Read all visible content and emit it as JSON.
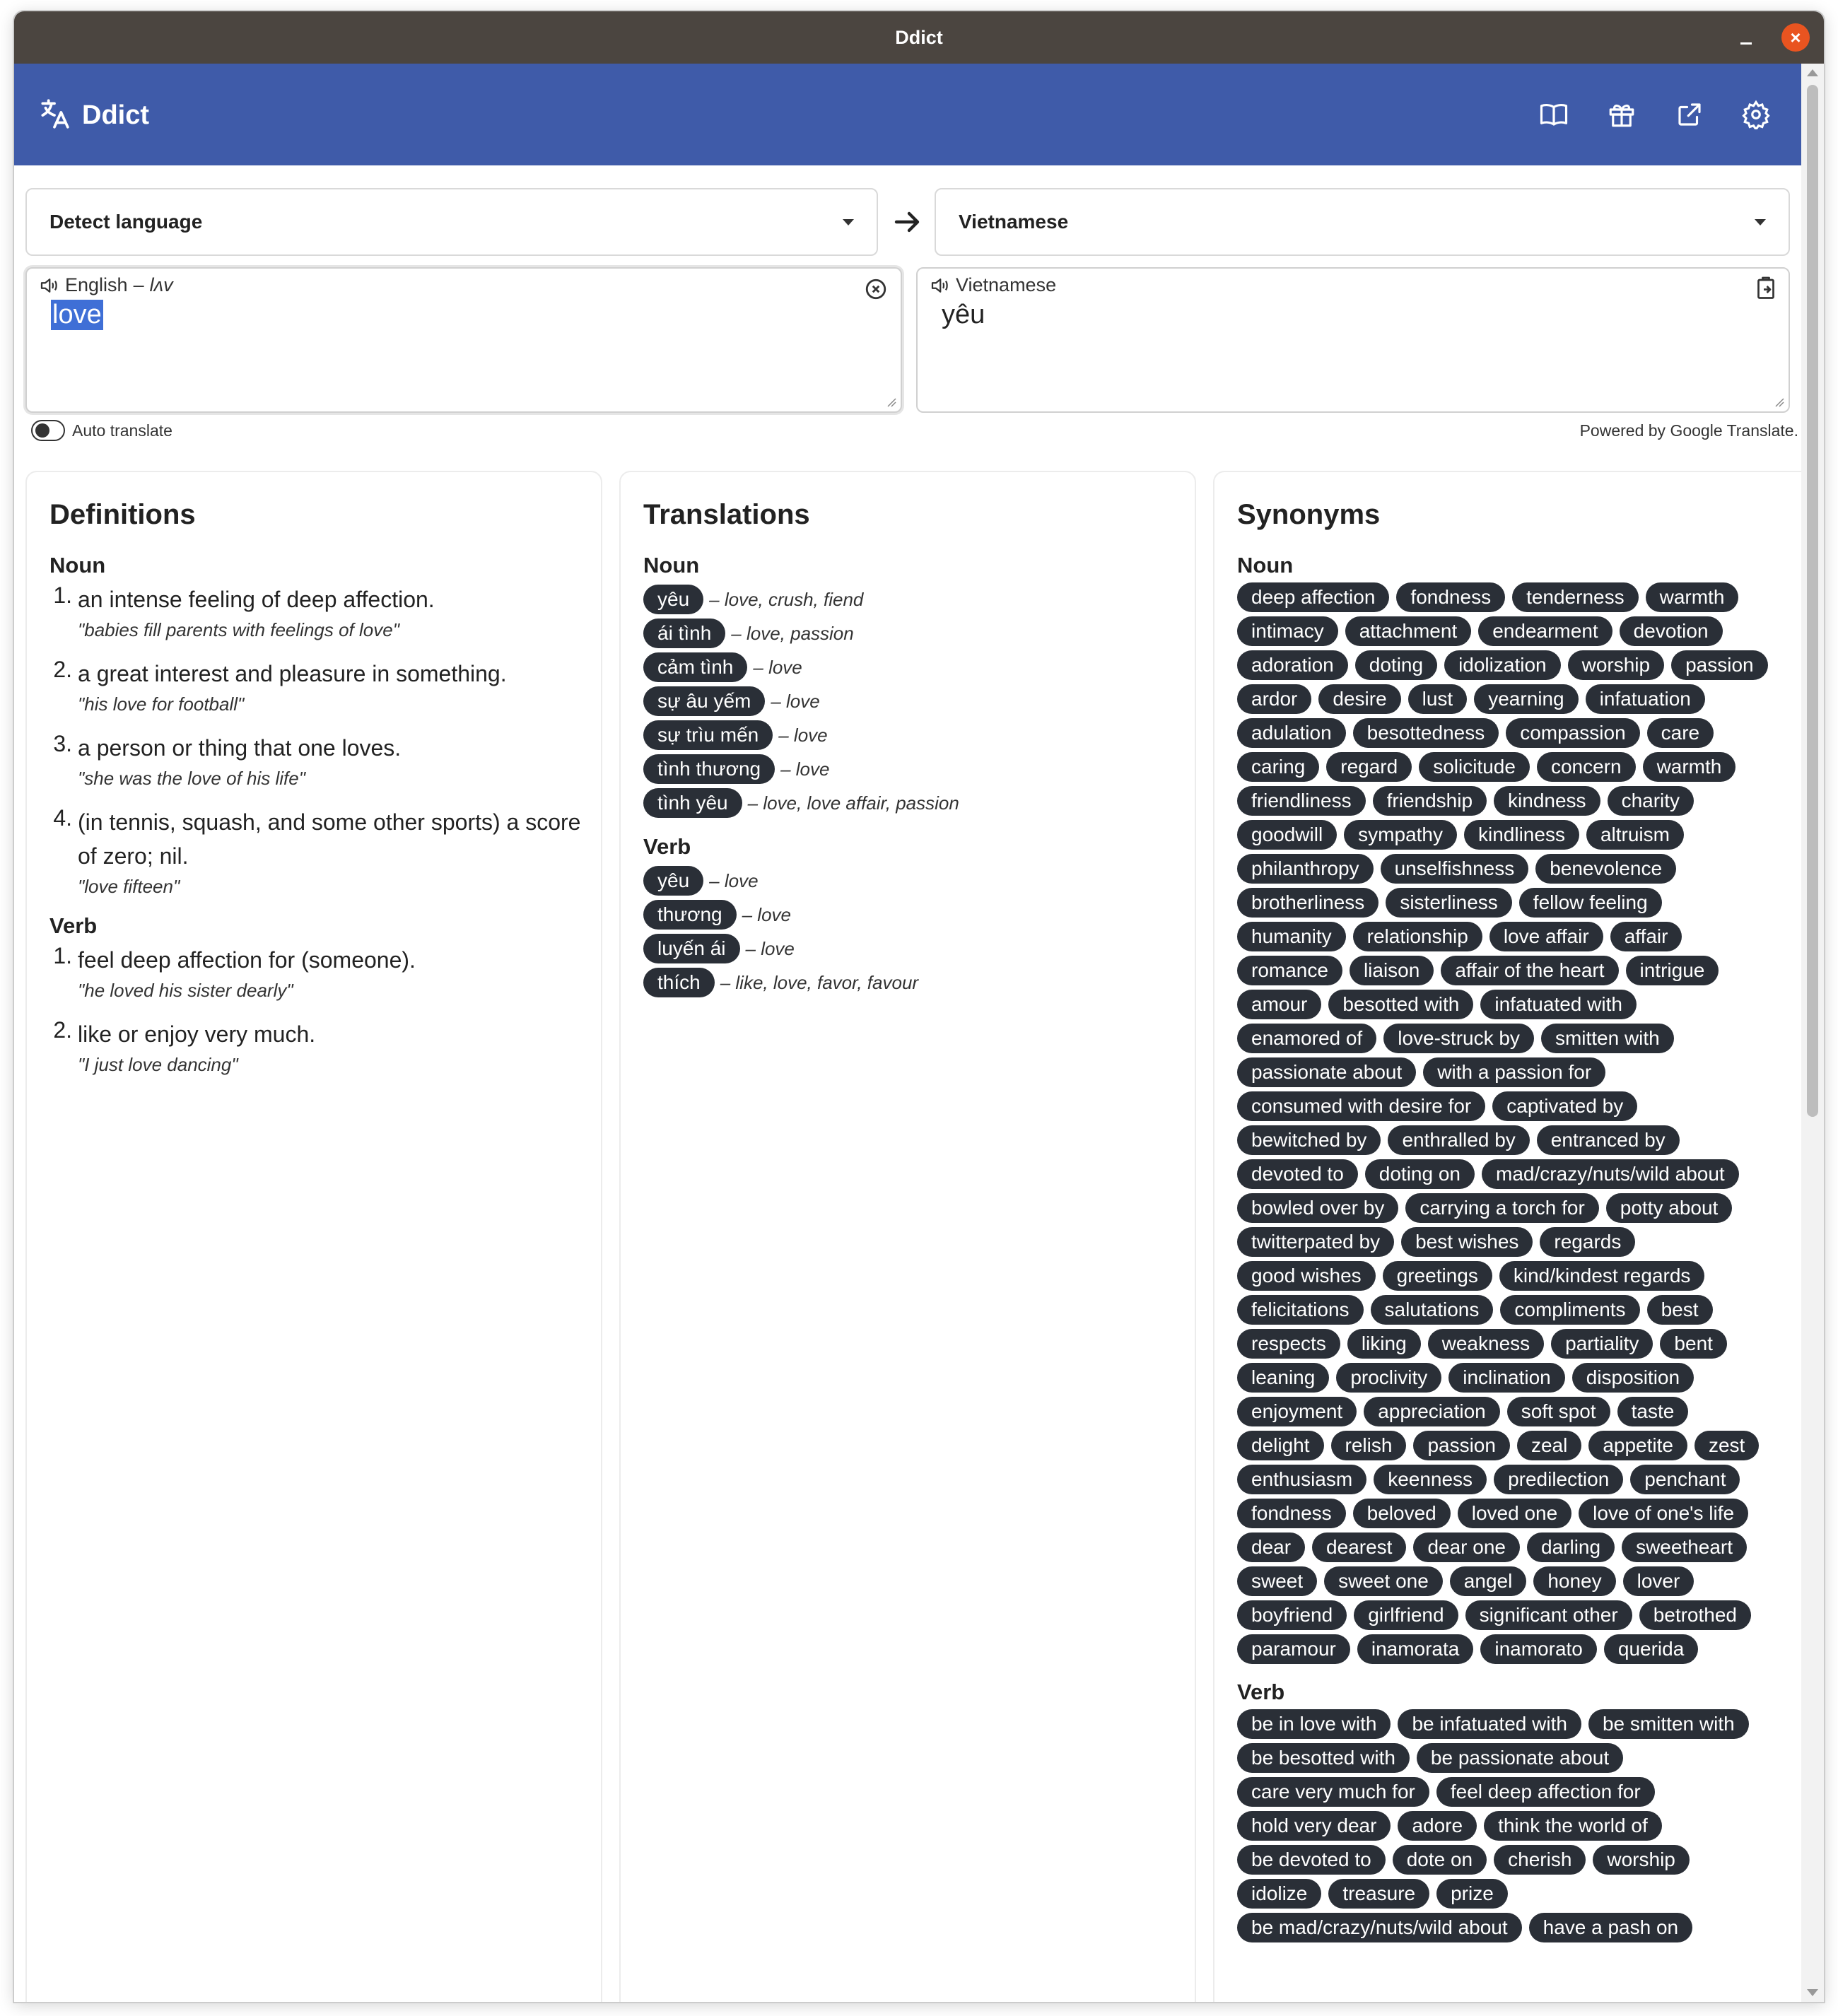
{
  "window": {
    "title": "Ddict"
  },
  "app": {
    "name": "Ddict"
  },
  "toolbar": {
    "icons": [
      "book-icon",
      "gift-icon",
      "external-link-icon",
      "gear-icon"
    ]
  },
  "source_lang": {
    "label": "Detect language"
  },
  "target_lang": {
    "label": "Vietnamese"
  },
  "input": {
    "lang": "English",
    "separator": "–",
    "phonetic": "lʌv",
    "text": "love"
  },
  "output": {
    "lang": "Vietnamese",
    "text": "yêu"
  },
  "auto_translate": {
    "label": "Auto translate"
  },
  "powered_by": "Powered by Google Translate.",
  "definitions": {
    "title": "Definitions",
    "groups": [
      {
        "pos": "Noun",
        "items": [
          {
            "num": "1.",
            "text": "an intense feeling of deep affection.",
            "example": "\"babies fill parents with feelings of love\""
          },
          {
            "num": "2.",
            "text": "a great interest and pleasure in something.",
            "example": "\"his love for football\""
          },
          {
            "num": "3.",
            "text": "a person or thing that one loves.",
            "example": "\"she was the love of his life\""
          },
          {
            "num": "4.",
            "text": "(in tennis, squash, and some other sports) a score of zero; nil.",
            "example": "\"love fifteen\""
          }
        ]
      },
      {
        "pos": "Verb",
        "items": [
          {
            "num": "1.",
            "text": "feel deep affection for (someone).",
            "example": "\"he loved his sister dearly\""
          },
          {
            "num": "2.",
            "text": "like or enjoy very much.",
            "example": "\"I just love dancing\""
          }
        ]
      }
    ]
  },
  "translations": {
    "title": "Translations",
    "groups": [
      {
        "pos": "Noun",
        "items": [
          {
            "word": "yêu",
            "meaning": "– love, crush, fiend"
          },
          {
            "word": "ái tình",
            "meaning": "– love, passion"
          },
          {
            "word": "cảm tình",
            "meaning": "– love"
          },
          {
            "word": "sự âu yếm",
            "meaning": "– love"
          },
          {
            "word": "sự trìu mến",
            "meaning": "– love"
          },
          {
            "word": "tình thương",
            "meaning": "– love"
          },
          {
            "word": "tình yêu",
            "meaning": "– love, love affair, passion"
          }
        ]
      },
      {
        "pos": "Verb",
        "items": [
          {
            "word": "yêu",
            "meaning": "– love"
          },
          {
            "word": "thương",
            "meaning": "– love"
          },
          {
            "word": "luyến ái",
            "meaning": "– love"
          },
          {
            "word": "thích",
            "meaning": "– like, love, favor, favour"
          }
        ]
      }
    ]
  },
  "synonyms": {
    "title": "Synonyms",
    "groups": [
      {
        "pos": "Noun",
        "items": [
          "deep affection",
          "fondness",
          "tenderness",
          "warmth",
          "intimacy",
          "attachment",
          "endearment",
          "devotion",
          "adoration",
          "doting",
          "idolization",
          "worship",
          "passion",
          "ardor",
          "desire",
          "lust",
          "yearning",
          "infatuation",
          "adulation",
          "besottedness",
          "compassion",
          "care",
          "caring",
          "regard",
          "solicitude",
          "concern",
          "warmth",
          "friendliness",
          "friendship",
          "kindness",
          "charity",
          "goodwill",
          "sympathy",
          "kindliness",
          "altruism",
          "philanthropy",
          "unselfishness",
          "benevolence",
          "brotherliness",
          "sisterliness",
          "fellow feeling",
          "humanity",
          "relationship",
          "love affair",
          "affair",
          "romance",
          "liaison",
          "affair of the heart",
          "intrigue",
          "amour",
          "besotted with",
          "infatuated with",
          "enamored of",
          "love-struck by",
          "smitten with",
          "passionate about",
          "with a passion for",
          "consumed with desire for",
          "captivated by",
          "bewitched by",
          "enthralled by",
          "entranced by",
          "devoted to",
          "doting on",
          "mad/crazy/nuts/wild about",
          "bowled over by",
          "carrying a torch for",
          "potty about",
          "twitterpated by",
          "best wishes",
          "regards",
          "good wishes",
          "greetings",
          "kind/kindest regards",
          "felicitations",
          "salutations",
          "compliments",
          "best",
          "respects",
          "liking",
          "weakness",
          "partiality",
          "bent",
          "leaning",
          "proclivity",
          "inclination",
          "disposition",
          "enjoyment",
          "appreciation",
          "soft spot",
          "taste",
          "delight",
          "relish",
          "passion",
          "zeal",
          "appetite",
          "zest",
          "enthusiasm",
          "keenness",
          "predilection",
          "penchant",
          "fondness",
          "beloved",
          "loved one",
          "love of one's life",
          "dear",
          "dearest",
          "dear one",
          "darling",
          "sweetheart",
          "sweet",
          "sweet one",
          "angel",
          "honey",
          "lover",
          "boyfriend",
          "girlfriend",
          "significant other",
          "betrothed",
          "paramour",
          "inamorata",
          "inamorato",
          "querida"
        ]
      },
      {
        "pos": "Verb",
        "items": [
          "be in love with",
          "be infatuated with",
          "be smitten with",
          "be besotted with",
          "be passionate about",
          "care very much for",
          "feel deep affection for",
          "hold very dear",
          "adore",
          "think the world of",
          "be devoted to",
          "dote on",
          "cherish",
          "worship",
          "idolize",
          "treasure",
          "prize",
          "be mad/crazy/nuts/wild about",
          "have a pash on"
        ]
      }
    ]
  }
}
